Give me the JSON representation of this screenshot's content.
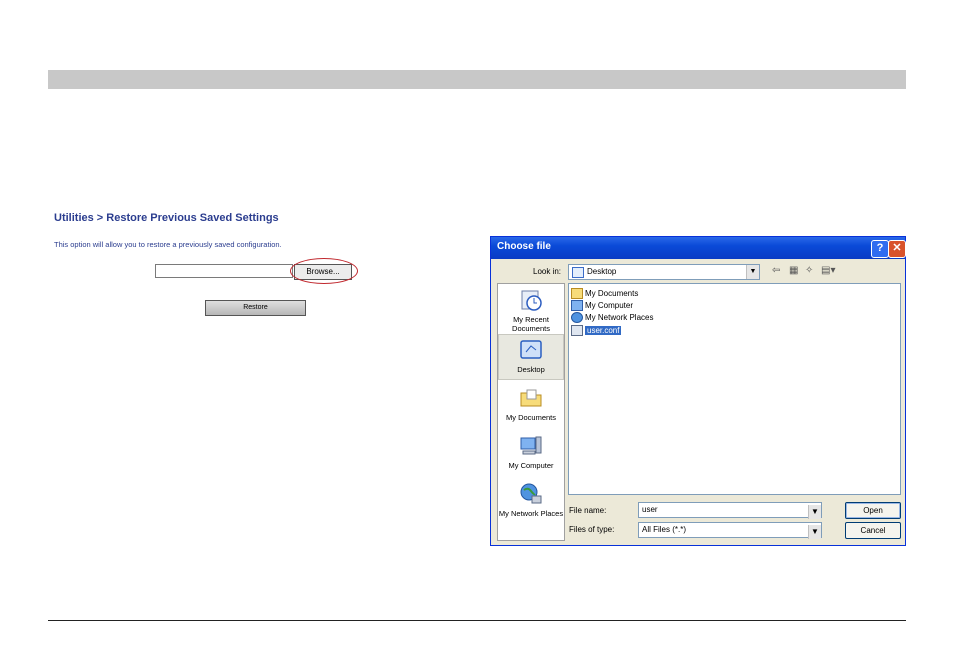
{
  "router_page": {
    "title": "Utilities > Restore Previous Saved Settings",
    "description": "This option will allow you to restore a previously saved configuration.",
    "browse_label": "Browse...",
    "restore_label": "Restore",
    "file_value": ""
  },
  "dialog": {
    "title": "Choose file",
    "help_label": "?",
    "close_label": "✕",
    "look_in_label": "Look in:",
    "look_in_value": "Desktop",
    "places": [
      "My Recent Documents",
      "Desktop",
      "My Documents",
      "My Computer",
      "My Network Places"
    ],
    "files": [
      "My Documents",
      "My Computer",
      "My Network Places",
      "user.conf"
    ],
    "selected_file": "user.conf",
    "file_name_label": "File name:",
    "file_name_value": "user",
    "files_of_type_label": "Files of type:",
    "files_of_type_value": "All Files (*.*)",
    "open_label": "Open",
    "cancel_label": "Cancel"
  },
  "colors": {
    "title_text": "#2b3d8f",
    "highlight": "#c0282e",
    "titlebar": "#0a4ad8",
    "selection": "#316ac5"
  },
  "icons": {
    "back": "arrow-left-icon",
    "up": "up-folder-icon",
    "new_folder": "new-folder-icon",
    "views": "views-menu-icon"
  }
}
